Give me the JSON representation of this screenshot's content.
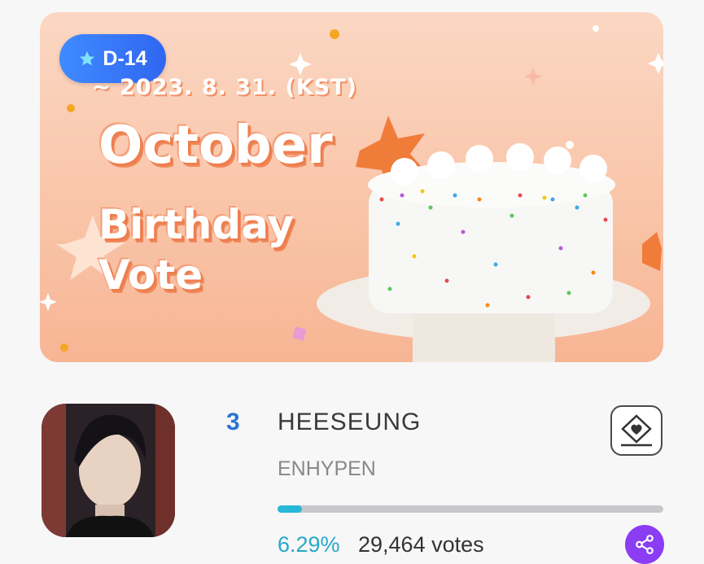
{
  "banner": {
    "dday_badge": "D-14",
    "deadline": "~ 2023. 8. 31. (KST)",
    "title_line1": "October",
    "title_line2": "Birthday",
    "title_line3": "Vote",
    "image_subject": "cake-with-sprinkles"
  },
  "candidate": {
    "rank": "3",
    "name": "HEESEUNG",
    "group": "ENHYPEN",
    "percent_text": "6.29%",
    "percent_value": 6.29,
    "votes_text": "29,464 votes"
  },
  "icons": {
    "vote": "heart-diamond-vote-icon",
    "share": "share-icon",
    "star": "star-icon"
  },
  "colors": {
    "accent_blue": "#3066f2",
    "progress": "#27b8d9",
    "share_bg": "#8a3df2",
    "rank": "#2d74d7"
  }
}
